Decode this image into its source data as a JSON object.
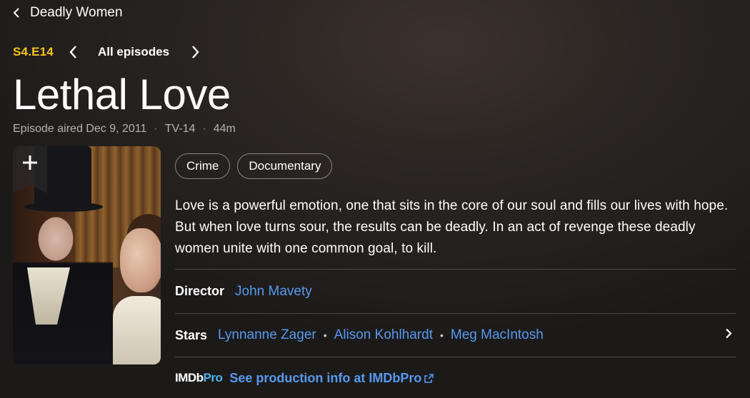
{
  "header": {
    "back_label": "Deadly Women"
  },
  "episode_nav": {
    "code": "S4.E14",
    "all_episodes_label": "All episodes"
  },
  "title": "Lethal Love",
  "meta": {
    "aired": "Episode aired Dec 9, 2011",
    "rating": "TV-14",
    "runtime": "44m"
  },
  "genres": [
    "Crime",
    "Documentary"
  ],
  "plot": "Love is a powerful emotion, one that sits in the core of our soul and fills our lives with hope. But when love turns sour, the results can be deadly. In an act of revenge these deadly women unite with one common goal, to kill.",
  "credits": {
    "director_label": "Director",
    "director": "John Mavety",
    "stars_label": "Stars",
    "stars": [
      "Lynnanne Zager",
      "Alison Kohlhardt",
      "Meg MacIntosh"
    ]
  },
  "imdbpro": {
    "logo_imdb": "IMDb",
    "logo_pro": "Pro",
    "link_label": "See production info at IMDbPro"
  },
  "colors": {
    "accent_yellow": "#f5c518",
    "link_blue": "#5799ef"
  }
}
